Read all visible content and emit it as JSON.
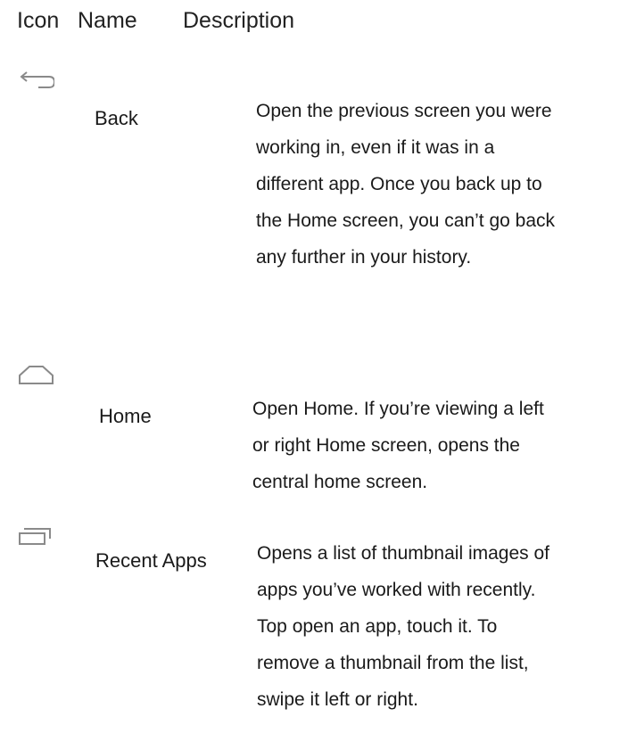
{
  "header": {
    "icon_col": "Icon",
    "name_col": "Name",
    "description_col": "Description"
  },
  "rows": [
    {
      "icon": "back-icon",
      "name": "Back",
      "description_lines": [
        "Open the previous screen you were",
        "working in, even if it was in a",
        "different app. Once you back up to",
        "the Home screen, you can’t go back",
        "any further in your history."
      ]
    },
    {
      "icon": "home-icon",
      "name": "Home",
      "description_lines": [
        "Open Home. If you’re viewing a left",
        "or right Home screen, opens the",
        "central home screen."
      ]
    },
    {
      "icon": "recent-apps-icon",
      "name": "Recent Apps",
      "description_lines": [
        "Opens a list of thumbnail images of",
        "apps you’ve worked with recently.",
        "Top open an app, touch it. To",
        "remove a thumbnail from the list,",
        "swipe it left or right."
      ]
    }
  ],
  "colors": {
    "icon_stroke": "#8a8a8a",
    "text": "#1a1a1a"
  }
}
